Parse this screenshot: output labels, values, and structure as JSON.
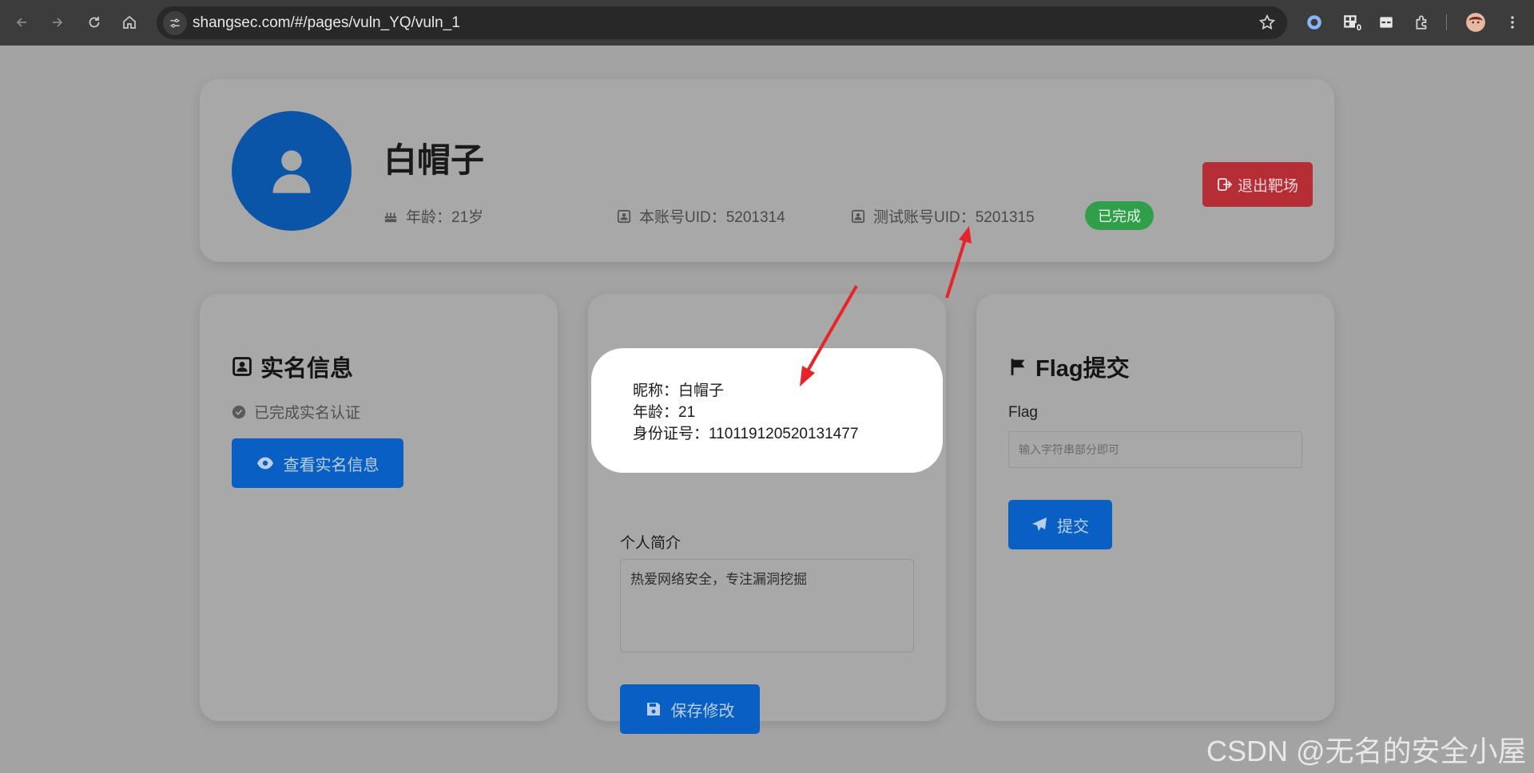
{
  "browser": {
    "url": "shangsec.com/#/pages/vuln_YQ/vuln_1",
    "extension_badge": "0"
  },
  "profile": {
    "name": "白帽子",
    "age": "年龄：21岁",
    "account_uid": "本账号UID：5201314",
    "test_uid": "测试账号UID：5201315",
    "status": "已完成",
    "exit_label": "退出靶场"
  },
  "realname": {
    "title": "实名信息",
    "verified": "已完成实名认证",
    "view_label": "查看实名信息"
  },
  "popup": {
    "nickname": "昵称：白帽子",
    "age": "年龄：21",
    "id_number": "身份证号：110119120520131477"
  },
  "bio": {
    "label": "个人简介",
    "value": "热爱网络安全，专注漏洞挖掘",
    "save_label": "保存修改"
  },
  "flag": {
    "title": "Flag提交",
    "label": "Flag",
    "placeholder": "输入字符串部分即可",
    "submit_label": "提交"
  },
  "watermark": "CSDN @无名的安全小屋",
  "colors": {
    "accent_blue": "#0a5fc4",
    "danger_red": "#b52d35",
    "success_green": "#2f9f49",
    "annotation_red": "#e8232a"
  }
}
